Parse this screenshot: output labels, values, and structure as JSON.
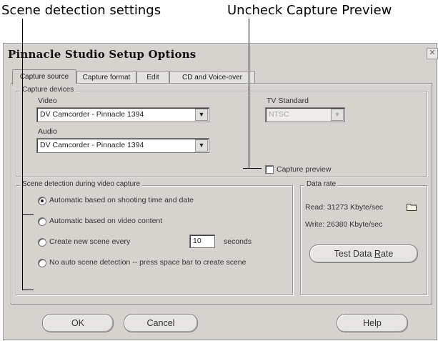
{
  "callouts": {
    "left": "Scene detection settings",
    "right": "Uncheck Capture Preview"
  },
  "window": {
    "title": "Pinnacle Studio Setup Options",
    "close_glyph": "✕"
  },
  "tabs": [
    {
      "label": "Capture source",
      "active": true
    },
    {
      "label": "Capture format",
      "active": false
    },
    {
      "label": "Edit",
      "active": false
    },
    {
      "label": "CD and Voice-over",
      "active": false
    }
  ],
  "capture_devices": {
    "legend": "Capture devices",
    "video_label": "Video",
    "video_value": "DV Camcorder - Pinnacle 1394",
    "audio_label": "Audio",
    "audio_value": "DV Camcorder - Pinnacle 1394",
    "tv_standard_label": "TV Standard",
    "tv_standard_value": "NTSC",
    "capture_preview_label": "Capture preview",
    "capture_preview_checked": false,
    "dropdown_arrow": "▼"
  },
  "scene_detection": {
    "legend": "Scene detection during video capture",
    "options": [
      {
        "label": "Automatic based on shooting time and date",
        "checked": true
      },
      {
        "label": "Automatic based on video content",
        "checked": false
      },
      {
        "label": "Create new scene every",
        "checked": false
      },
      {
        "label": "No auto scene detection -- press space bar to create scene",
        "checked": false
      }
    ],
    "interval_value": "10",
    "interval_unit": "seconds"
  },
  "data_rate": {
    "legend": "Data rate",
    "read": "Read: 31273 Kbyte/sec",
    "write": "Write: 26380 Kbyte/sec",
    "test_button_prefix": "Test Data ",
    "test_button_accel": "R",
    "test_button_suffix": "ate",
    "folder_icon": "folder-icon"
  },
  "buttons": {
    "ok": "OK",
    "cancel": "Cancel",
    "help": "Help"
  },
  "colors": {
    "dialog_bg": "#d6d3ce",
    "callout_line": "#000000"
  }
}
